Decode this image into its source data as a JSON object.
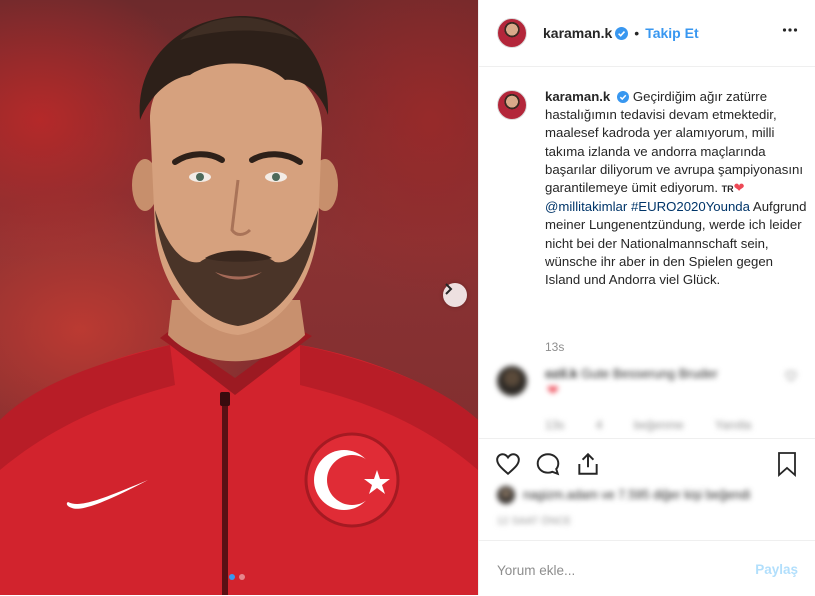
{
  "post": {
    "username": "karaman.k",
    "follow_label": "Takip Et",
    "separator": "•",
    "more_icon": "ellipsis-icon",
    "carousel": {
      "total_slides": 2,
      "active_slide": 1
    }
  },
  "caption": {
    "username": "karaman.k",
    "text_tr": "Geçirdiğim ağır zatürre hastalığımın tedavisi devam etmektedir, maalesef kadroda yer alamıyorum, milli takıma izlanda ve andorra maçlarında başarılar diliyorum ve avrupa şampiyonasını garantilemeye ümit ediyorum.",
    "flag": "TR",
    "heart": "❤",
    "mention": "@millitakimlar",
    "hashtag": "#EURO2020Younda",
    "text_de": "Aufgrund meiner Lungenentzündung, werde ich leider nicht bei der Nationalmannschaft sein, wünsche ihr aber in den Spielen gegen Island und Andorra viel Glück.",
    "time": "13s"
  },
  "comment": {
    "username": "ozil.k",
    "text": "Gute Besserung Bruder",
    "heart": "❤",
    "time": "13s",
    "likes": "4 beğenme",
    "reply": "Yanıtla",
    "like_icon": "heart-outline-icon"
  },
  "actions": {
    "like_icon": "heart-outline-icon",
    "comment_icon": "speech-bubble-icon",
    "share_icon": "share-icon",
    "save_icon": "bookmark-icon"
  },
  "likes": {
    "text": "nagizm.adam ve 7.595 diğer kişi beğendi"
  },
  "date": "12 SAAT ÖNCE",
  "comment_box": {
    "placeholder": "Yorum ekle...",
    "post_label": "Paylaş"
  },
  "colors": {
    "accent": "#3897f0",
    "post_disabled": "#b2dffc",
    "heart": "#ed4956",
    "hashtag": "#003569",
    "muted": "#8e8e8e"
  }
}
